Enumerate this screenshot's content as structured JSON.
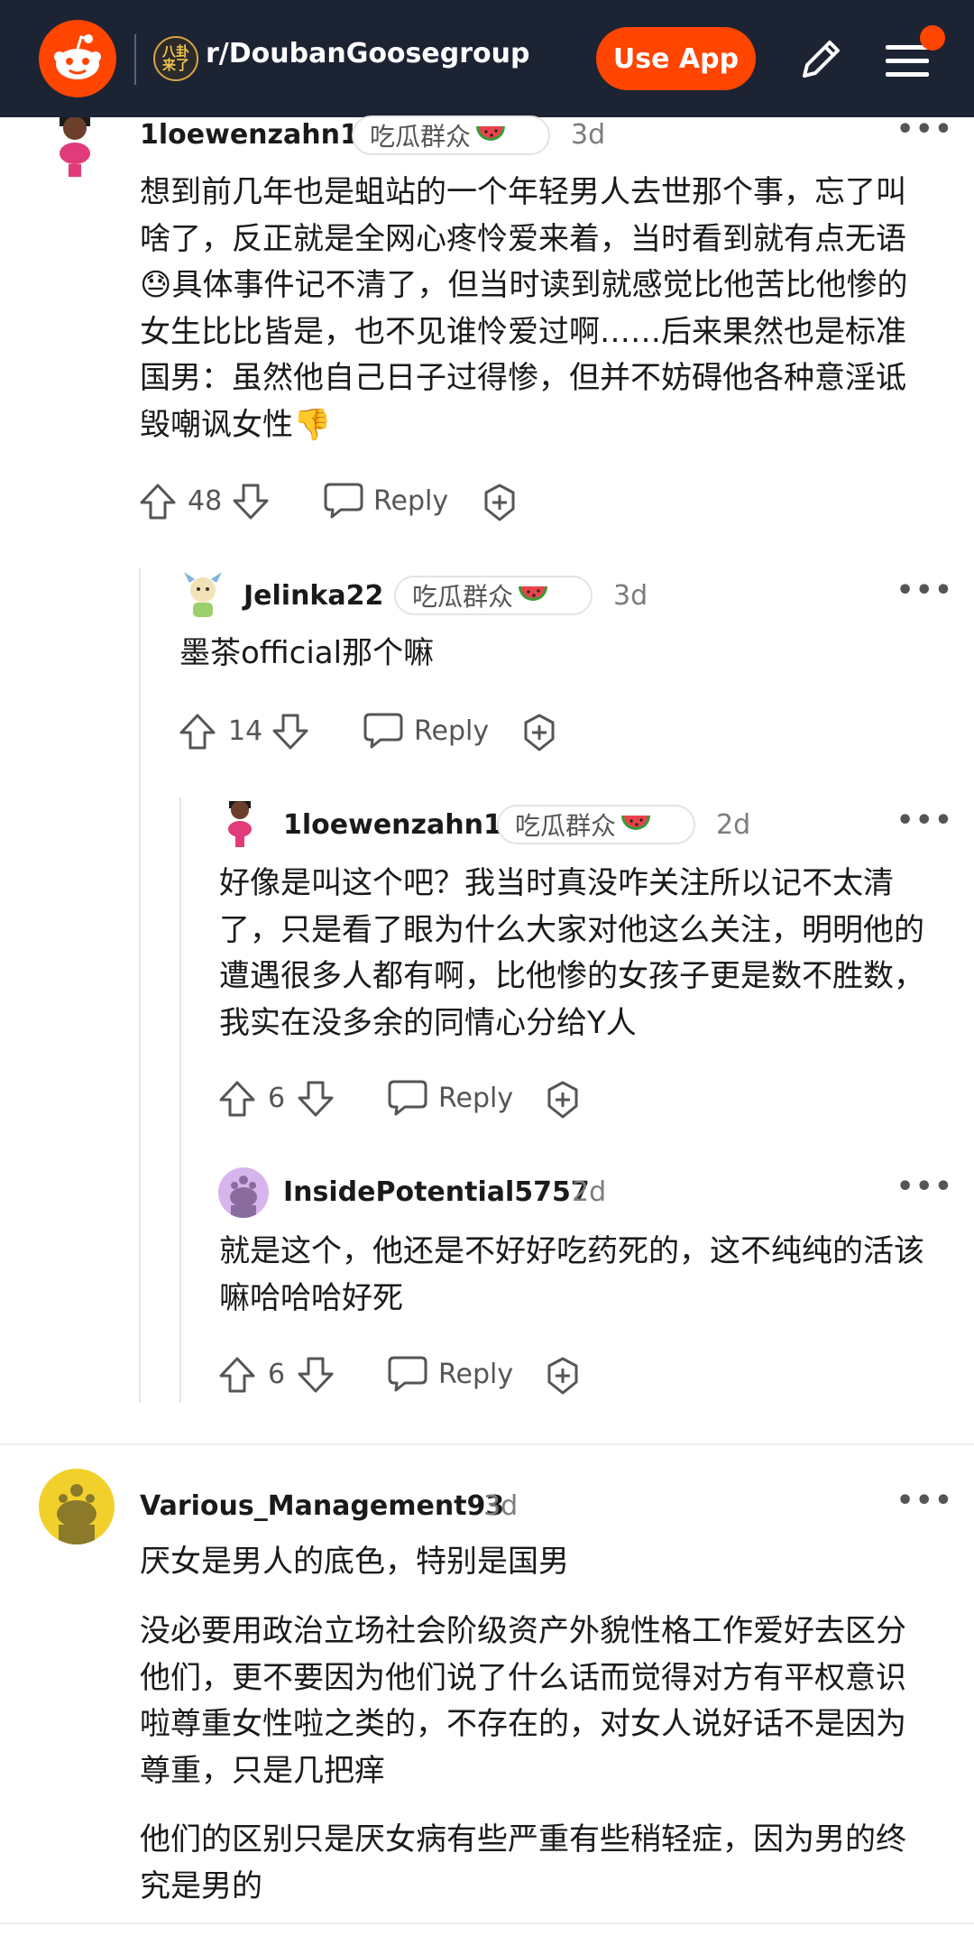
{
  "header": {
    "subreddit": "r/DoubanGoosegroup",
    "subreddit_icon_text": "八卦\n来了",
    "use_app": "Use App"
  },
  "comments": [
    {
      "username": "1loewenzahn1",
      "flair": "吃瓜群众",
      "time": "3d",
      "text": "想到前几年也是蛆站的一个年轻男人去世那个事，忘了叫啥了，反正就是全网心疼怜爱来着，当时看到就有点无语😓具体事件记不清了，但当时读到就感觉比他苦比他惨的女生比比皆是，也不见谁怜爱过啊……后来果然也是标准国男：虽然他自己日子过得惨，但并不妨碍他各种意淫诋毁嘲讽女性👎",
      "votes": "48",
      "reply": "Reply"
    },
    {
      "username": "Jelinka22",
      "flair": "吃瓜群众",
      "time": "3d",
      "text": "墨茶official那个嘛",
      "votes": "14",
      "reply": "Reply"
    },
    {
      "username": "1loewenzahn1",
      "flair": "吃瓜群众",
      "time": "2d",
      "text": "好像是叫这个吧？我当时真没咋关注所以记不太清了，只是看了眼为什么大家对他这么关注，明明他的遭遇很多人都有啊，比他惨的女孩子更是数不胜数，我实在没多余的同情心分给Y人",
      "votes": "6",
      "reply": "Reply"
    },
    {
      "username": "InsidePotential5757",
      "time": "2d",
      "text": "就是这个，他还是不好好吃药死的，这不纯纯的活该嘛哈哈哈好死",
      "votes": "6",
      "reply": "Reply"
    },
    {
      "username": "Various_Management93",
      "time": "3d",
      "paragraphs": [
        "厌女是男人的底色，特别是国男",
        "没必要用政治立场社会阶级资产外貌性格工作爱好去区分他们，更不要因为他们说了什么话而觉得对方有平权意识啦尊重女性啦之类的，不存在的，对女人说好话不是因为尊重，只是几把痒",
        "他们的区别只是厌女病有些严重有些稍轻症，因为男的终究是男的"
      ]
    }
  ],
  "colors": {
    "header_bg": "#1c2333",
    "accent": "#ff4500"
  },
  "icons": [
    "reddit-logo-icon",
    "pencil-icon",
    "menu-icon",
    "upvote-icon",
    "downvote-icon",
    "reply-icon",
    "award-icon",
    "more-icon",
    "watermelon-icon"
  ]
}
